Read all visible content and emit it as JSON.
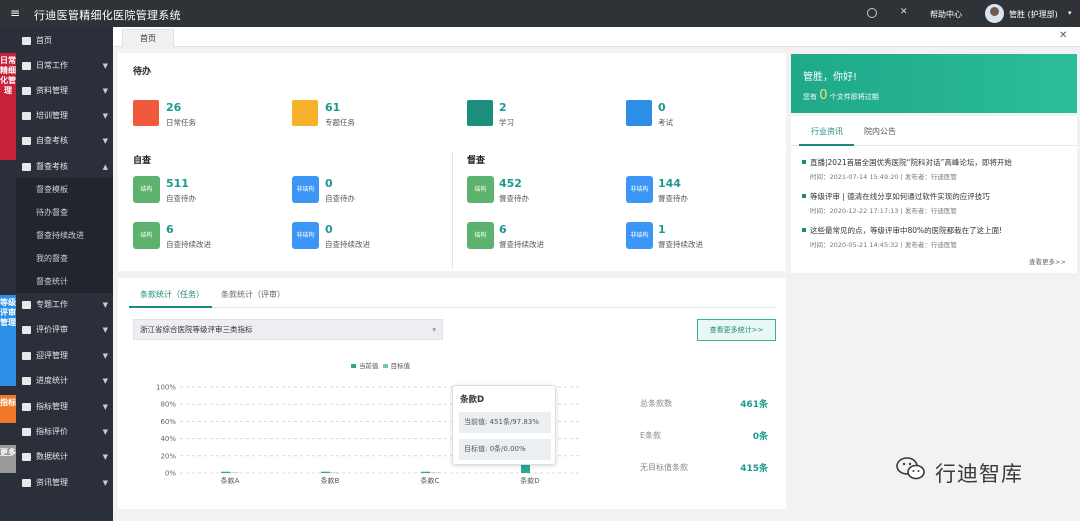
{
  "app": {
    "title": "行迪医管精细化医院管理系统",
    "help": "帮助中心",
    "user": "管胜 (护理部)"
  },
  "sidebar": {
    "groups": [
      {
        "label": "日常精细化管理",
        "color": "#c8213a"
      },
      {
        "label": "等级评审管理",
        "color": "#2d8ee8"
      },
      {
        "label": "指标",
        "color": "#f07a2c"
      },
      {
        "label": "更多",
        "color": "#9a9a9a"
      }
    ],
    "items": [
      {
        "label": "首页"
      },
      {
        "label": "日常工作"
      },
      {
        "label": "资料管理"
      },
      {
        "label": "培训管理"
      },
      {
        "label": "自查考核"
      },
      {
        "label": "督查考核"
      },
      {
        "label": "专题工作"
      },
      {
        "label": "评价评审"
      },
      {
        "label": "迎评管理"
      },
      {
        "label": "进度统计"
      },
      {
        "label": "指标管理"
      },
      {
        "label": "指标评价"
      },
      {
        "label": "数据统计"
      },
      {
        "label": "资讯管理"
      }
    ],
    "subitems": [
      "督查模板",
      "待办督查",
      "督查持续改进",
      "我的督查",
      "督查统计"
    ]
  },
  "tabs": {
    "home": "首页"
  },
  "todo": {
    "title": "待办",
    "tiles": [
      {
        "num": "26",
        "label": "日常任务",
        "color": "#f05a3c"
      },
      {
        "num": "61",
        "label": "专题任务",
        "color": "#f7b12a"
      },
      {
        "num": "2",
        "label": "学习",
        "color": "#1c8f7c"
      },
      {
        "num": "0",
        "label": "考试",
        "color": "#2d8ee8"
      }
    ],
    "self_title": "自查",
    "supervise_title": "督查",
    "stats": [
      {
        "badge": "结构",
        "num": "511",
        "label": "自查待办"
      },
      {
        "badge": "非结构",
        "num": "0",
        "label": "自查待办"
      },
      {
        "badge": "结构",
        "num": "452",
        "label": "督查待办"
      },
      {
        "badge": "非结构",
        "num": "144",
        "label": "督查待办"
      },
      {
        "badge": "结构",
        "num": "6",
        "label": "自查持续改进"
      },
      {
        "badge": "非结构",
        "num": "0",
        "label": "自查持续改进"
      },
      {
        "badge": "结构",
        "num": "6",
        "label": "督查持续改进"
      },
      {
        "badge": "非结构",
        "num": "1",
        "label": "督查持续改进"
      }
    ]
  },
  "welcome": {
    "greeting": "管胜，你好!",
    "files_prefix": "您有",
    "files_count": "0",
    "files_suffix": "个文件即将过期"
  },
  "news": {
    "tabs": [
      "行业资讯",
      "院内公告"
    ],
    "items": [
      {
        "title": "直播|2021首届全国优秀医院“院科对话”高峰论坛，即将开始",
        "meta": "时间：2021-07-14 15:49:20 | 发布者：行迪医管"
      },
      {
        "title": "等级评审 | 德清在线分享如何通过软件实现的应评技巧",
        "meta": "时间：2020-12-22 17:17:13 | 发布者：行迪医管"
      },
      {
        "title": "这些最常见的点，等级评审中80%的医院都栽在了这上面!",
        "meta": "时间：2020-05-21 14:45:32 | 发布者：行迪医管"
      }
    ],
    "more": "查看更多>>"
  },
  "stats": {
    "tabs": [
      "条款统计（任务）",
      "条款统计（评审）"
    ],
    "select": "浙江省综合医院等级评审三类指标",
    "more": "查看更多统计>>",
    "legend": [
      "当前值",
      "目标值"
    ],
    "summary": [
      {
        "label": "总条款数",
        "value": "461条"
      },
      {
        "label": "E条款",
        "value": "0条"
      },
      {
        "label": "无目标值条款",
        "value": "415条"
      }
    ],
    "tooltip": {
      "title": "条款D",
      "current": "当前值: 451条/97.83%",
      "target": "目标值: 0条/0.00%"
    }
  },
  "chart_data": {
    "type": "bar",
    "categories": [
      "条款A",
      "条款B",
      "条款C",
      "条款D"
    ],
    "series": [
      {
        "name": "当前值",
        "values": [
          1.5,
          1.5,
          1.5,
          97.83
        ],
        "color": "#2aa898"
      },
      {
        "name": "目标值",
        "values": [
          0.5,
          0.5,
          0.5,
          0
        ],
        "color": "#6fc8c0"
      }
    ],
    "yticks": [
      "0%",
      "20%",
      "40%",
      "60%",
      "80%",
      "100%"
    ],
    "ylim": [
      0,
      100
    ],
    "grid": true,
    "legend": "top-center"
  },
  "watermark": {
    "text": "行迪智库"
  }
}
